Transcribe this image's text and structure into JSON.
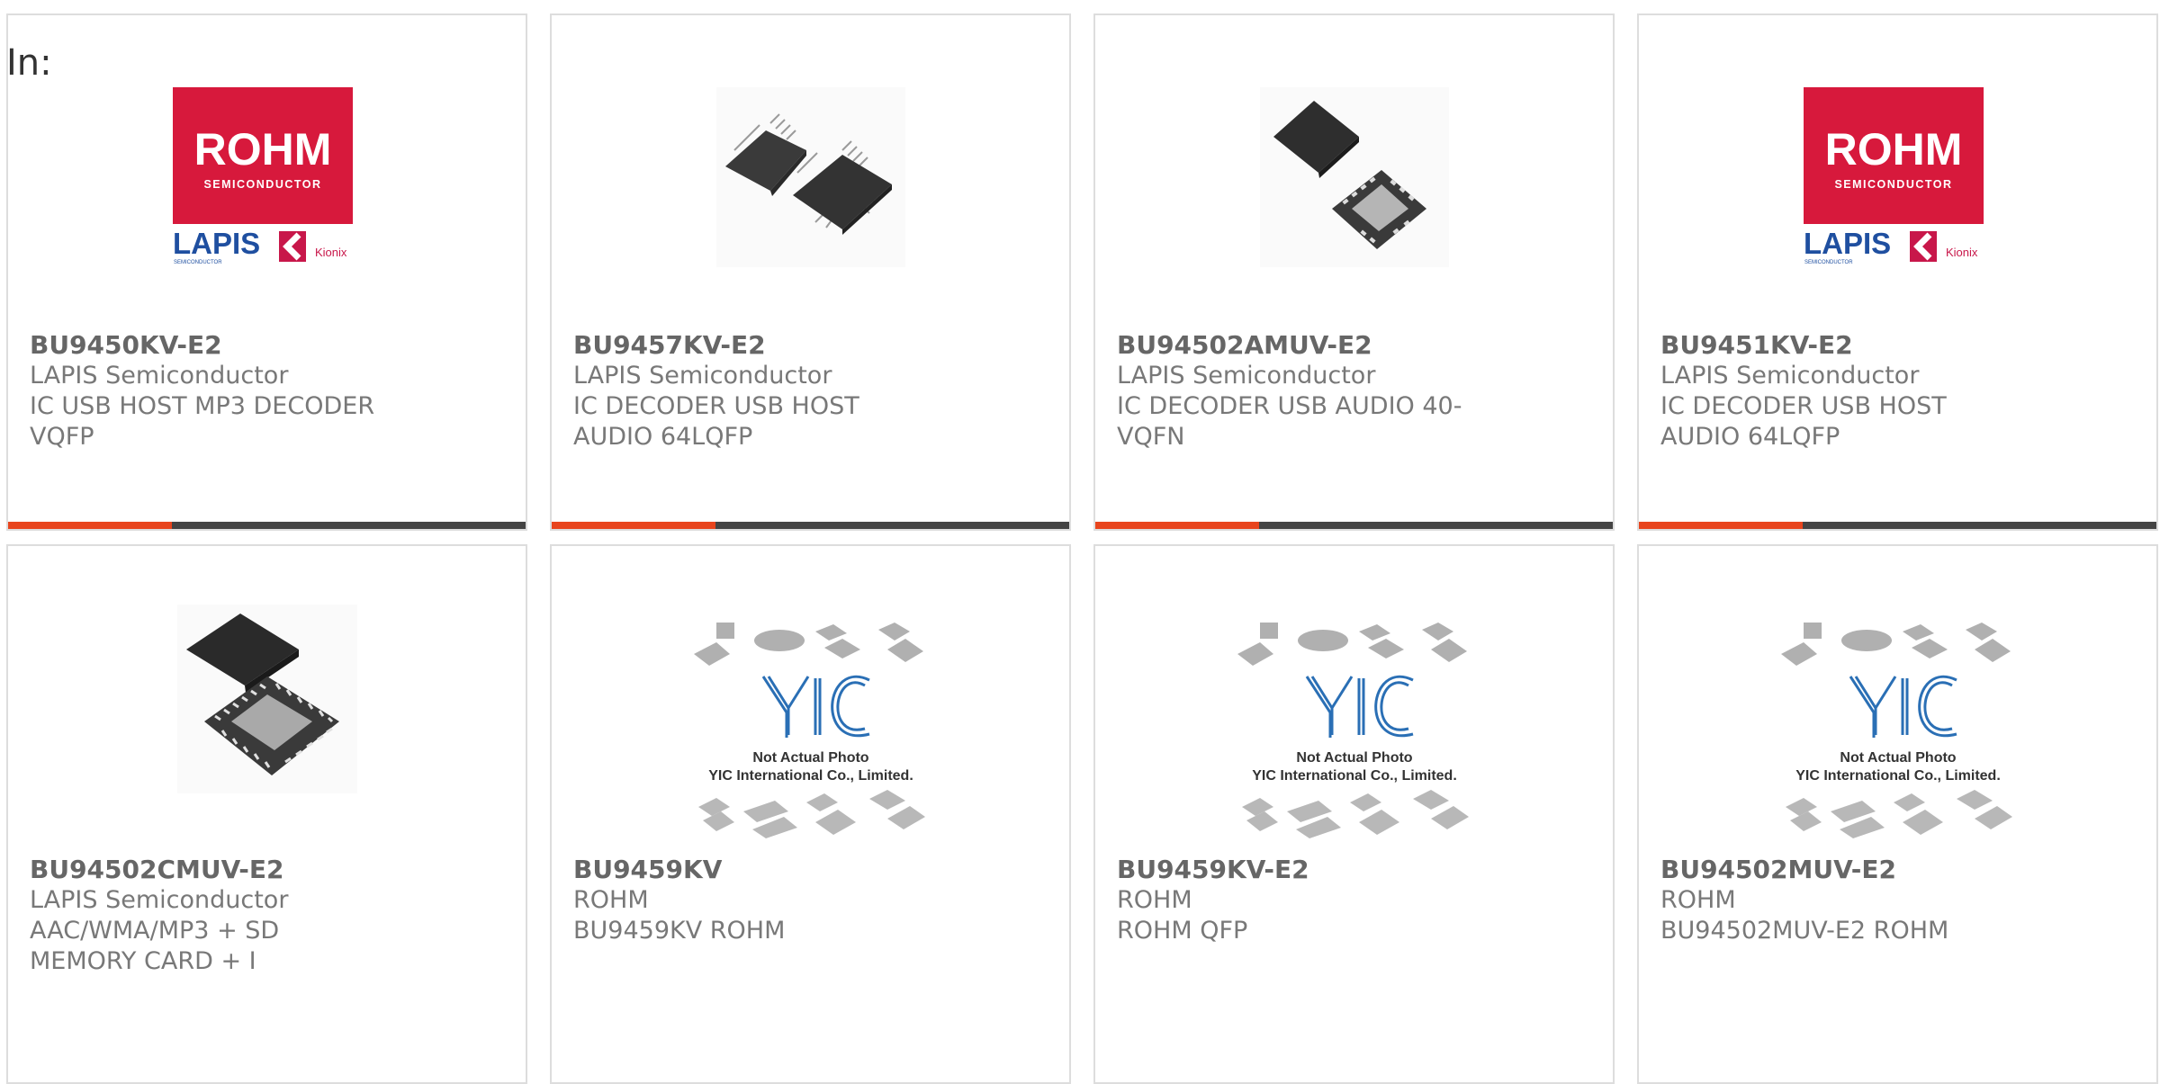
{
  "header": {
    "label": "In:"
  },
  "cards": [
    {
      "part": "BU9450KV-E2",
      "maker": "LAPIS Semiconductor",
      "desc": "IC USB HOST MP3 DECODER VQFP",
      "image": "rohm-lapis-logo"
    },
    {
      "part": "BU9457KV-E2",
      "maker": "LAPIS Semiconductor",
      "desc": "IC DECODER USB HOST AUDIO 64LQFP",
      "image": "qfp-chip-photo"
    },
    {
      "part": "BU94502AMUV-E2",
      "maker": "LAPIS Semiconductor",
      "desc": "IC DECODER USB AUDIO 40-VQFN",
      "image": "vqfn-chip-photo"
    },
    {
      "part": "BU9451KV-E2",
      "maker": "LAPIS Semiconductor",
      "desc": "IC DECODER USB HOST AUDIO 64LQFP",
      "image": "rohm-lapis-logo"
    },
    {
      "part": "BU94502CMUV-E2",
      "maker": "LAPIS Semiconductor",
      "desc": "AAC/WMA/MP3 + SD MEMORY CARD + I",
      "image": "qfn-chip-photo"
    },
    {
      "part": "BU9459KV",
      "maker": "ROHM",
      "desc": "BU9459KV ROHM",
      "image": "yic-placeholder"
    },
    {
      "part": "BU9459KV-E2",
      "maker": "ROHM",
      "desc": "ROHM QFP",
      "image": "yic-placeholder"
    },
    {
      "part": "BU94502MUV-E2",
      "maker": "ROHM",
      "desc": "BU94502MUV-E2 ROHM",
      "image": "yic-placeholder"
    }
  ],
  "logo": {
    "brand": "ROHM",
    "sub": "SEMICONDUCTOR",
    "lapis": "LAPIS",
    "lapis_sub": "SEMICONDUCTOR",
    "kionix": "Kionix"
  },
  "placeholder": {
    "brand": "YIC",
    "line1": "Not Actual Photo",
    "line2": "YIC International Co., Limited."
  },
  "colors": {
    "accent": "#e8451e",
    "bar": "#444444",
    "rohm_red": "#d7193c",
    "lapis_blue": "#1f4fa0",
    "yic_blue": "#2a6fb5"
  }
}
